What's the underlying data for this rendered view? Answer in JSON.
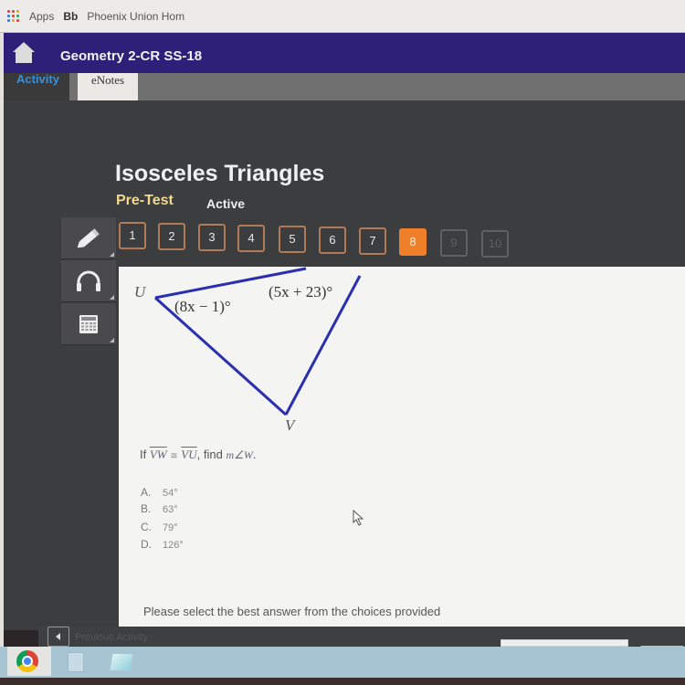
{
  "browser": {
    "bookmarks": [
      {
        "label": "Apps",
        "icon": "apps-grid-icon"
      },
      {
        "label": "Bb",
        "icon": "blackboard-icon"
      },
      {
        "label": "Phoenix Union Hom",
        "icon": "bookmark-link"
      }
    ]
  },
  "header": {
    "course_title": "Geometry 2-CR SS-18",
    "home_icon": "home-icon"
  },
  "tabs": [
    {
      "label": "Activity",
      "active": true
    },
    {
      "label": "eNotes",
      "active": false
    }
  ],
  "lesson": {
    "title": "Isosceles Triangles",
    "type": "Pre-Test",
    "status": "Active"
  },
  "question_nav": {
    "current": 8,
    "items": [
      {
        "label": "1",
        "state": "answered"
      },
      {
        "label": "2",
        "state": "answered"
      },
      {
        "label": "3",
        "state": "answered"
      },
      {
        "label": "4",
        "state": "answered"
      },
      {
        "label": "5",
        "state": "answered"
      },
      {
        "label": "6",
        "state": "answered"
      },
      {
        "label": "7",
        "state": "answered"
      },
      {
        "label": "8",
        "state": "current"
      },
      {
        "label": "9",
        "state": "locked"
      },
      {
        "label": "10",
        "state": "locked"
      }
    ]
  },
  "tools": [
    {
      "name": "pencil",
      "icon": "pencil-icon"
    },
    {
      "name": "audio",
      "icon": "headphones-icon"
    },
    {
      "name": "calculator",
      "icon": "calculator-icon"
    }
  ],
  "figure": {
    "vertices": {
      "U": "U",
      "V": "V"
    },
    "angle_U": "(8x − 1)°",
    "angle_W": "(5x + 23)°",
    "line_color": "#2a2fb0"
  },
  "question": {
    "prefix": "If",
    "segment1": "VW",
    "congruent": "≅",
    "segment2": "VU",
    "mid": ", find",
    "target": "m∠W",
    "suffix": "."
  },
  "choices": [
    {
      "letter": "A.",
      "value": "54°"
    },
    {
      "letter": "B.",
      "value": "63°"
    },
    {
      "letter": "C.",
      "value": "79°"
    },
    {
      "letter": "D.",
      "value": "126°"
    }
  ],
  "instruction": "Please select the best answer from the choices provided",
  "footer": {
    "previous_label": "Previous Activity"
  },
  "colors": {
    "header_bg": "#2e1f78",
    "current_question": "#f07f2a",
    "pretest": "#f2d98c",
    "activity_tab": "#3b8fd4"
  }
}
